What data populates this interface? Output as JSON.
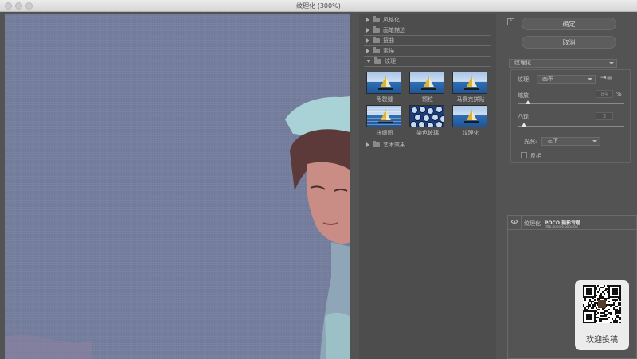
{
  "window": {
    "title": "纹理化 (300%)"
  },
  "filter_gallery": {
    "categories": [
      {
        "label": "风格化",
        "expanded": false
      },
      {
        "label": "画笔描边",
        "expanded": false
      },
      {
        "label": "扭曲",
        "expanded": false
      },
      {
        "label": "素描",
        "expanded": false
      },
      {
        "label": "纹理",
        "expanded": true
      },
      {
        "label": "艺术效果",
        "expanded": false
      }
    ],
    "texture_filters": [
      {
        "label": "龟裂缝",
        "icon": "cracks-thumbnail"
      },
      {
        "label": "颗粒",
        "icon": "grain-thumbnail"
      },
      {
        "label": "马赛克拼贴",
        "icon": "mosaic-tiles-thumbnail"
      },
      {
        "label": "拼缀图",
        "icon": "patchwork-thumbnail"
      },
      {
        "label": "染色玻璃",
        "icon": "stained-glass-thumbnail"
      },
      {
        "label": "纹理化",
        "icon": "texturizer-thumbnail",
        "selected": true
      }
    ]
  },
  "settings": {
    "ok_label": "确定",
    "cancel_label": "取消",
    "filter_select": "纹理化",
    "texture_label": "纹理:",
    "texture_value": "画布",
    "scaling_label": "缩放",
    "scaling_value": "84",
    "scaling_unit": "%",
    "scaling_fraction": 0.1,
    "relief_label": "凸现",
    "relief_value": "3",
    "relief_fraction": 0.06,
    "light_label": "光照:",
    "light_value": "左下",
    "invert_label": "反相",
    "invert_checked": false
  },
  "layers": {
    "row_label": "纹理化",
    "watermark": "POCO 摄影专题",
    "watermark_url": "http://photo.poco.cn/"
  },
  "qr_card": {
    "label": "欢迎投稿"
  },
  "colors": {
    "panel": "#535353",
    "canvas_bg": "#7880a0",
    "titlebar": "#e4e4e4"
  }
}
